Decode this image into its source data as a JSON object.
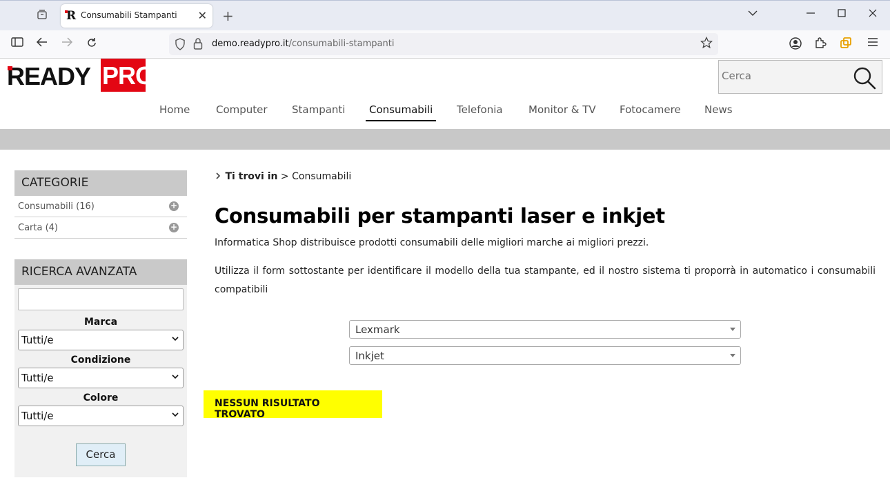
{
  "browser": {
    "tab_title": "Consumabili Stampanti",
    "url_domain": "demo.readypro.it",
    "url_path": "/consumabili-stampanti"
  },
  "site": {
    "logo_ready": "READY",
    "logo_pro": "PRO",
    "brand_color": "#e30613",
    "search_placeholder": "Cerca",
    "menu": [
      "Home",
      "Computer",
      "Stampanti",
      "Consumabili",
      "Telefonia",
      "Monitor & TV",
      "Fotocamere",
      "News"
    ],
    "active_menu": "Consumabili"
  },
  "sidebar": {
    "categories_title": "CATEGORIE",
    "categories": [
      {
        "label": "Consumabili (16)"
      },
      {
        "label": "Carta (4)"
      }
    ],
    "advanced_title": "RICERCA AVANZATA",
    "advanced_text_value": "",
    "marca_label": "Marca",
    "marca_value": "Tutti/e",
    "condizione_label": "Condizione",
    "condizione_value": "Tutti/e",
    "colore_label": "Colore",
    "colore_value": "Tutti/e",
    "search_button": "Cerca"
  },
  "main": {
    "breadcrumb_prefix": "Ti trovi in",
    "breadcrumb_separator": ">",
    "breadcrumb_current": "Consumabili",
    "title": "Consumabili per stampanti laser e inkjet",
    "intro": "Informatica Shop distribuisce prodotti consumabili delle migliori marche ai migliori prezzi.",
    "intro2": "Utilizza il form sottostante per identificare il modello della tua stampante, ed il nostro sistema ti proporrà in automatico i consumabili compatibili",
    "brand_select": "Lexmark",
    "type_select": "Inkjet",
    "no_result": "NESSUN RISULTATO TROVATO",
    "no_result_color": "#ffff00"
  }
}
